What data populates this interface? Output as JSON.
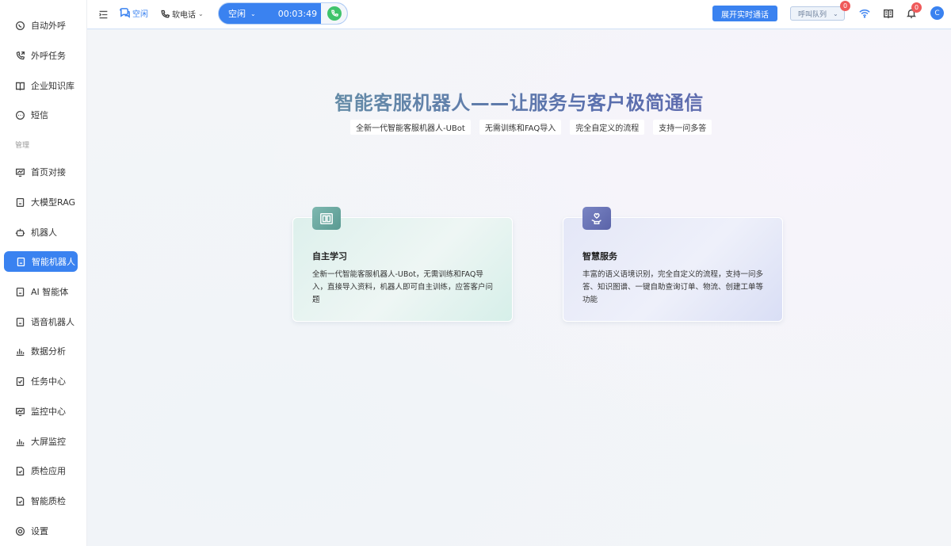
{
  "sidebar": {
    "section_label": "管理",
    "items": [
      {
        "label": "自动外呼",
        "icon": "whatsapp-icon"
      },
      {
        "label": "外呼任务",
        "icon": "phone-out-icon"
      },
      {
        "label": "企业知识库",
        "icon": "book-icon"
      },
      {
        "label": "短信",
        "icon": "sms-icon"
      },
      {
        "label": "首页对接",
        "icon": "monitor-chart-icon"
      },
      {
        "label": "大模型RAG",
        "icon": "robot-face-icon"
      },
      {
        "label": "机器人",
        "icon": "robot-icon"
      },
      {
        "label": "智能机器人",
        "icon": "robot-face-icon"
      },
      {
        "label": "AI 智能体",
        "icon": "robot-face-icon"
      },
      {
        "label": "语音机器人",
        "icon": "robot-face-icon"
      },
      {
        "label": "数据分析",
        "icon": "bar-chart-icon"
      },
      {
        "label": "任务中心",
        "icon": "task-check-icon"
      },
      {
        "label": "监控中心",
        "icon": "monitor-chart-icon"
      },
      {
        "label": "大屏监控",
        "icon": "bar-chart-icon"
      },
      {
        "label": "质检应用",
        "icon": "doc-check-icon"
      },
      {
        "label": "智能质检",
        "icon": "doc-check-icon"
      },
      {
        "label": "设置",
        "icon": "gear-icon"
      }
    ],
    "active_index": 7
  },
  "topbar": {
    "agent_status": "空闲",
    "phone_type": "软电话",
    "call_status": "空闲",
    "call_timer": "00:03:49",
    "expand_button": "展开实时通话",
    "queue_label": "呼叫队列",
    "queue_badge": "0",
    "notify_badge": "0",
    "avatar_letter": "C"
  },
  "main": {
    "title": "智能客服机器人——让服务与客户极简通信",
    "tags": [
      "全新一代智能客服机器人-UBot",
      "无需训练和FAQ导入",
      "完全自定义的流程",
      "支持一问多答"
    ],
    "cards": [
      {
        "title": "自主学习",
        "desc": "全新一代智能客服机器人-UBot，无需训练和FAQ导入，直接导入资料，机器人即可自主训练，应答客户问题"
      },
      {
        "title": "智慧服务",
        "desc": "丰富的语义语境识别，完全自定义的流程，支持一问多答、知识图谱、一键自助查询订单、物流、创建工单等功能"
      }
    ]
  }
}
